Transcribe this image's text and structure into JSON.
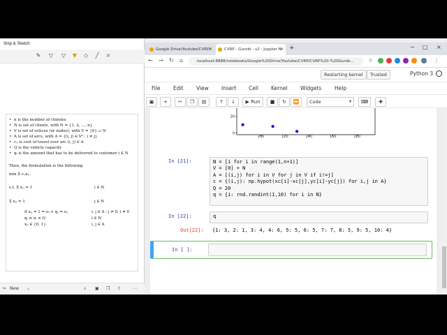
{
  "snip": {
    "title": "Snip & Sketch",
    "bottom_new": "New",
    "bullets": [
      "n is the number of clientes",
      "N is set of clients, with N = {1, 2, ..., n}",
      "V is set of vetices (or nodes), with V = {0} ∪ N",
      "A is set of arcs, with A = {(i, j) ∈ V² : i ≠ j}",
      "cᵢⱼ is cost of travel over arc (i, j) ∈ A",
      "Q is the vehicle capacity",
      "qᵢ is the amount that has to be delivered to customer i ∈ N"
    ],
    "then": "Then, the formulation is the following",
    "equations": [
      {
        "left": "min  Σ cᵢⱼxᵢⱼ",
        "cond": ""
      },
      {
        "left": "s.t.  Σ xᵢⱼ = 1",
        "cond": "i ∈ N"
      },
      {
        "left": "        Σ xᵢⱼ = 1",
        "cond": "j ∈ N"
      },
      {
        "left": "if xᵢⱼ = 1 ⇒ uᵢ + qⱼ = uⱼ",
        "cond": "i, j ∈ A : j ≠ 0, i ≠ 0"
      },
      {
        "left": "qᵢ ≤ uᵢ ≤ Q",
        "cond": "i ∈ N"
      },
      {
        "left": "xᵢⱼ ∈ {0, 1}",
        "cond": "i, j ∈ A"
      }
    ]
  },
  "browser": {
    "tabs": [
      {
        "label": "Google Drive/Youtube/CVRP/",
        "active": false
      },
      {
        "label": "CVRP - Gurobi - v2 - Jupyter N",
        "active": true
      }
    ],
    "url": "localhost:8888/notebooks/Google%20Drive/Youtube/CVRP/CVRP%20-%20Gurob..."
  },
  "jupyter": {
    "status": "Restarting kernel",
    "trusted": "Trusted",
    "kernel": "Python 3",
    "menu": [
      "File",
      "Edit",
      "View",
      "Insert",
      "Cell",
      "Kernel",
      "Widgets",
      "Help"
    ],
    "run_label": "Run",
    "cell_type": "Code",
    "cells": [
      {
        "prompt": "In [21]:",
        "code": "N = [i for i in range(1,n+1)]\nV = [0] + N\nA = [(i,j) for i in V for j in V if i!=j]\nc = {(i,j): np.hypot(xc[i]-xc[j],yc[i]-yc[j]) for i,j in A}\nQ = 20\nq = {i: rnd.randint(1,10) for i in N}"
      },
      {
        "prompt": "In [22]:",
        "code": "q",
        "out_prompt": "Out[22]:",
        "output": "{1: 3, 2: 1, 3: 4, 4: 6, 5: 5, 6: 5, 7: 7, 8: 5, 9: 5, 10: 4}"
      },
      {
        "prompt": "In [ ]:",
        "code": ""
      }
    ]
  },
  "chart_data": {
    "type": "scatter",
    "x": [
      85,
      110,
      130
    ],
    "y": [
      10,
      8,
      2
    ],
    "xticks": [
      "100",
      "120",
      "140",
      "160",
      "180"
    ],
    "yticks": [
      "20",
      "0"
    ],
    "xlim": [
      80,
      195
    ],
    "ylim": [
      -2,
      30
    ],
    "point_color": "#1f1fd0"
  }
}
